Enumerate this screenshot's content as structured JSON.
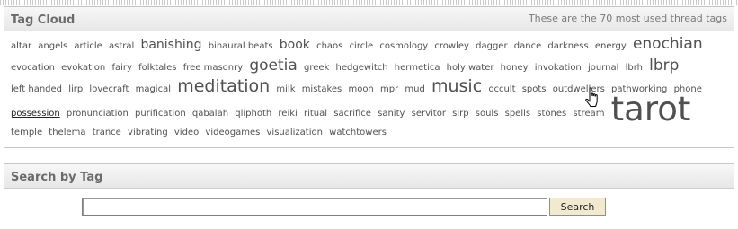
{
  "tag_cloud": {
    "title": "Tag Cloud",
    "note": "These are the 70 most used thread tags",
    "tags": [
      {
        "label": "altar",
        "size": 1
      },
      {
        "label": "angels",
        "size": 1
      },
      {
        "label": "article",
        "size": 1
      },
      {
        "label": "astral",
        "size": 1
      },
      {
        "label": "banishing",
        "size": 2
      },
      {
        "label": "binaural beats",
        "size": 1
      },
      {
        "label": "book",
        "size": 2
      },
      {
        "label": "chaos",
        "size": 1
      },
      {
        "label": "circle",
        "size": 1
      },
      {
        "label": "cosmology",
        "size": 1
      },
      {
        "label": "crowley",
        "size": 1
      },
      {
        "label": "dagger",
        "size": 1
      },
      {
        "label": "dance",
        "size": 1
      },
      {
        "label": "darkness",
        "size": 1
      },
      {
        "label": "energy",
        "size": 1
      },
      {
        "label": "enochian",
        "size": 3
      },
      {
        "label": "evocation",
        "size": 1
      },
      {
        "label": "evokation",
        "size": 1
      },
      {
        "label": "fairy",
        "size": 1
      },
      {
        "label": "folktales",
        "size": 1
      },
      {
        "label": "free masonry",
        "size": 1
      },
      {
        "label": "goetia",
        "size": 3
      },
      {
        "label": "greek",
        "size": 1
      },
      {
        "label": "hedgewitch",
        "size": 1
      },
      {
        "label": "hermetica",
        "size": 1
      },
      {
        "label": "holy water",
        "size": 1
      },
      {
        "label": "honey",
        "size": 1
      },
      {
        "label": "invokation",
        "size": 1
      },
      {
        "label": "journal",
        "size": 1
      },
      {
        "label": "lbrh",
        "size": 1
      },
      {
        "label": "lbrp",
        "size": 3
      },
      {
        "label": "left handed",
        "size": 1
      },
      {
        "label": "lirp",
        "size": 1
      },
      {
        "label": "lovecraft",
        "size": 1
      },
      {
        "label": "magical",
        "size": 1
      },
      {
        "label": "meditation",
        "size": 4
      },
      {
        "label": "milk",
        "size": 1
      },
      {
        "label": "mistakes",
        "size": 1
      },
      {
        "label": "moon",
        "size": 1
      },
      {
        "label": "mpr",
        "size": 1
      },
      {
        "label": "mud",
        "size": 1
      },
      {
        "label": "music",
        "size": 4
      },
      {
        "label": "occult",
        "size": 1
      },
      {
        "label": "spots",
        "size": 1
      },
      {
        "label": "outdwellers",
        "size": 1
      },
      {
        "label": "pathworking",
        "size": 1
      },
      {
        "label": "phone",
        "size": 1
      },
      {
        "label": "possession",
        "size": 1,
        "hover": true
      },
      {
        "label": "pronunciation",
        "size": 1
      },
      {
        "label": "purification",
        "size": 1
      },
      {
        "label": "qabalah",
        "size": 1
      },
      {
        "label": "qliphoth",
        "size": 1
      },
      {
        "label": "reiki",
        "size": 1
      },
      {
        "label": "ritual",
        "size": 1
      },
      {
        "label": "sacrifice",
        "size": 1
      },
      {
        "label": "sanity",
        "size": 1
      },
      {
        "label": "servitor",
        "size": 1
      },
      {
        "label": "sirp",
        "size": 1
      },
      {
        "label": "souls",
        "size": 1
      },
      {
        "label": "spells",
        "size": 1
      },
      {
        "label": "stones",
        "size": 1
      },
      {
        "label": "stream",
        "size": 1
      },
      {
        "label": "tarot",
        "size": 5
      },
      {
        "label": "temple",
        "size": 1
      },
      {
        "label": "thelema",
        "size": 1
      },
      {
        "label": "trance",
        "size": 1
      },
      {
        "label": "vibrating",
        "size": 1
      },
      {
        "label": "video",
        "size": 1
      },
      {
        "label": "videogames",
        "size": 1
      },
      {
        "label": "visualization",
        "size": 1
      },
      {
        "label": "watchtowers",
        "size": 1
      }
    ]
  },
  "search_by_tag": {
    "title": "Search by Tag",
    "input_value": "",
    "button_label": "Search"
  },
  "icons": {
    "cursor": "hand-pointer-icon"
  }
}
